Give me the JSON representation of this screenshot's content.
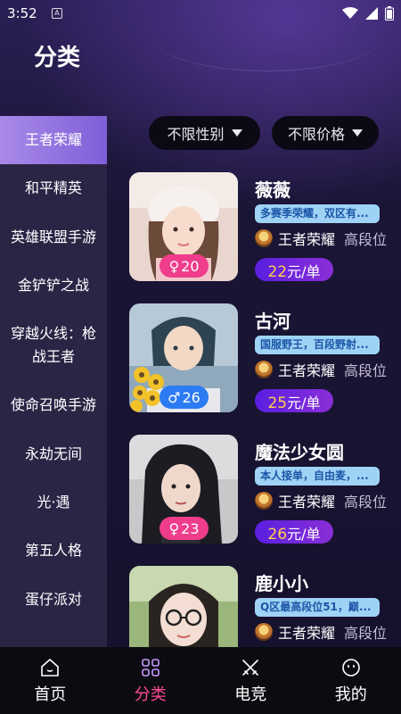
{
  "status_bar": {
    "time": "3:52",
    "notif_letter": "A"
  },
  "page_title": "分类",
  "sidebar": {
    "items": [
      {
        "label": "王者荣耀",
        "active": true
      },
      {
        "label": "和平精英",
        "active": false
      },
      {
        "label": "英雄联盟手游",
        "active": false
      },
      {
        "label": "金铲铲之战",
        "active": false
      },
      {
        "label": "穿越火线：枪战王者",
        "active": false
      },
      {
        "label": "使命召唤手游",
        "active": false
      },
      {
        "label": "永劫无间",
        "active": false
      },
      {
        "label": "光·遇",
        "active": false
      },
      {
        "label": "第五人格",
        "active": false
      },
      {
        "label": "蛋仔派对",
        "active": false
      }
    ]
  },
  "filters": {
    "gender": "不限性别",
    "price": "不限价格"
  },
  "players": [
    {
      "name": "薇薇",
      "gender_symbol": "♀",
      "age": "20",
      "desc": "多赛季荣耀，双区有...",
      "game": "王者荣耀",
      "rank": "高段位",
      "price": "22",
      "unit": "元/单"
    },
    {
      "name": "古河",
      "gender_symbol": "♂",
      "age": "26",
      "desc": "国服野王，百段野射...",
      "game": "王者荣耀",
      "rank": "高段位",
      "price": "25",
      "unit": "元/单"
    },
    {
      "name": "魔法少女圆",
      "gender_symbol": "♀",
      "age": "23",
      "desc": "本人接单，自由麦，...",
      "game": "王者荣耀",
      "rank": "高段位",
      "price": "26",
      "unit": "元/单"
    },
    {
      "name": "鹿小小",
      "gender_symbol": "♀",
      "age": "",
      "desc": "Q区最高段位51，巅...",
      "game": "王者荣耀",
      "rank": "高段位",
      "price": "",
      "unit": ""
    }
  ],
  "bottom_nav": {
    "items": [
      {
        "label": "首页",
        "icon": "home-icon",
        "active": false
      },
      {
        "label": "分类",
        "icon": "category-grid-icon",
        "active": true
      },
      {
        "label": "电竞",
        "icon": "crossed-swords-icon",
        "active": false
      },
      {
        "label": "我的",
        "icon": "smiley-icon",
        "active": false
      }
    ]
  },
  "colors": {
    "accent_pink": "#ff4a8e",
    "sidebar_active": "#8f70e0",
    "price_yellow": "#ffd24a"
  }
}
